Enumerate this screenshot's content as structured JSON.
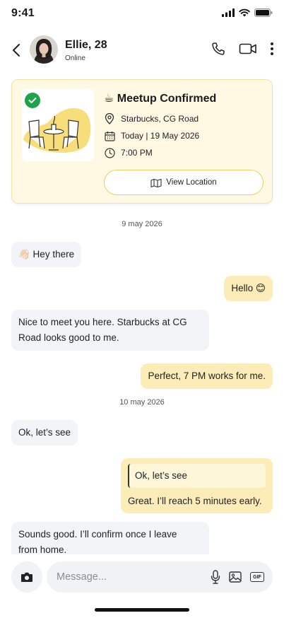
{
  "status_bar": {
    "time": "9:41"
  },
  "header": {
    "name": "Ellie, 28",
    "status": "Online"
  },
  "meetup": {
    "title": "☕ Meetup Confirmed",
    "location": "Starbucks, CG Road",
    "date": "Today | 19 May 2026",
    "time": "7:00 PM",
    "button_label": "View Location"
  },
  "dates": {
    "first": "9 may 2026",
    "second": "10 may 2026"
  },
  "messages": {
    "m1": "👋🏻 Hey there",
    "m2": "Hello 😊",
    "m3_line1": "Nice to meet you here. Starbucks at CG",
    "m3_line2": "Road looks good to me.",
    "m4": "Perfect, 7 PM works for me.",
    "m5": "Ok, let’s see",
    "m6_quote": "Ok, let’s see",
    "m6_text": "Great. I’ll reach 5 minutes early.",
    "m7_line1": "Sounds good. I’ll confirm once I leave",
    "m7_line2": "from home."
  },
  "composer": {
    "placeholder": "Message...",
    "gif_label": "GIF"
  },
  "colors": {
    "accent": "#fcedb8",
    "card_bg": "#fff9e3",
    "check": "#1fa34a",
    "incoming": "#f3f4f8"
  }
}
